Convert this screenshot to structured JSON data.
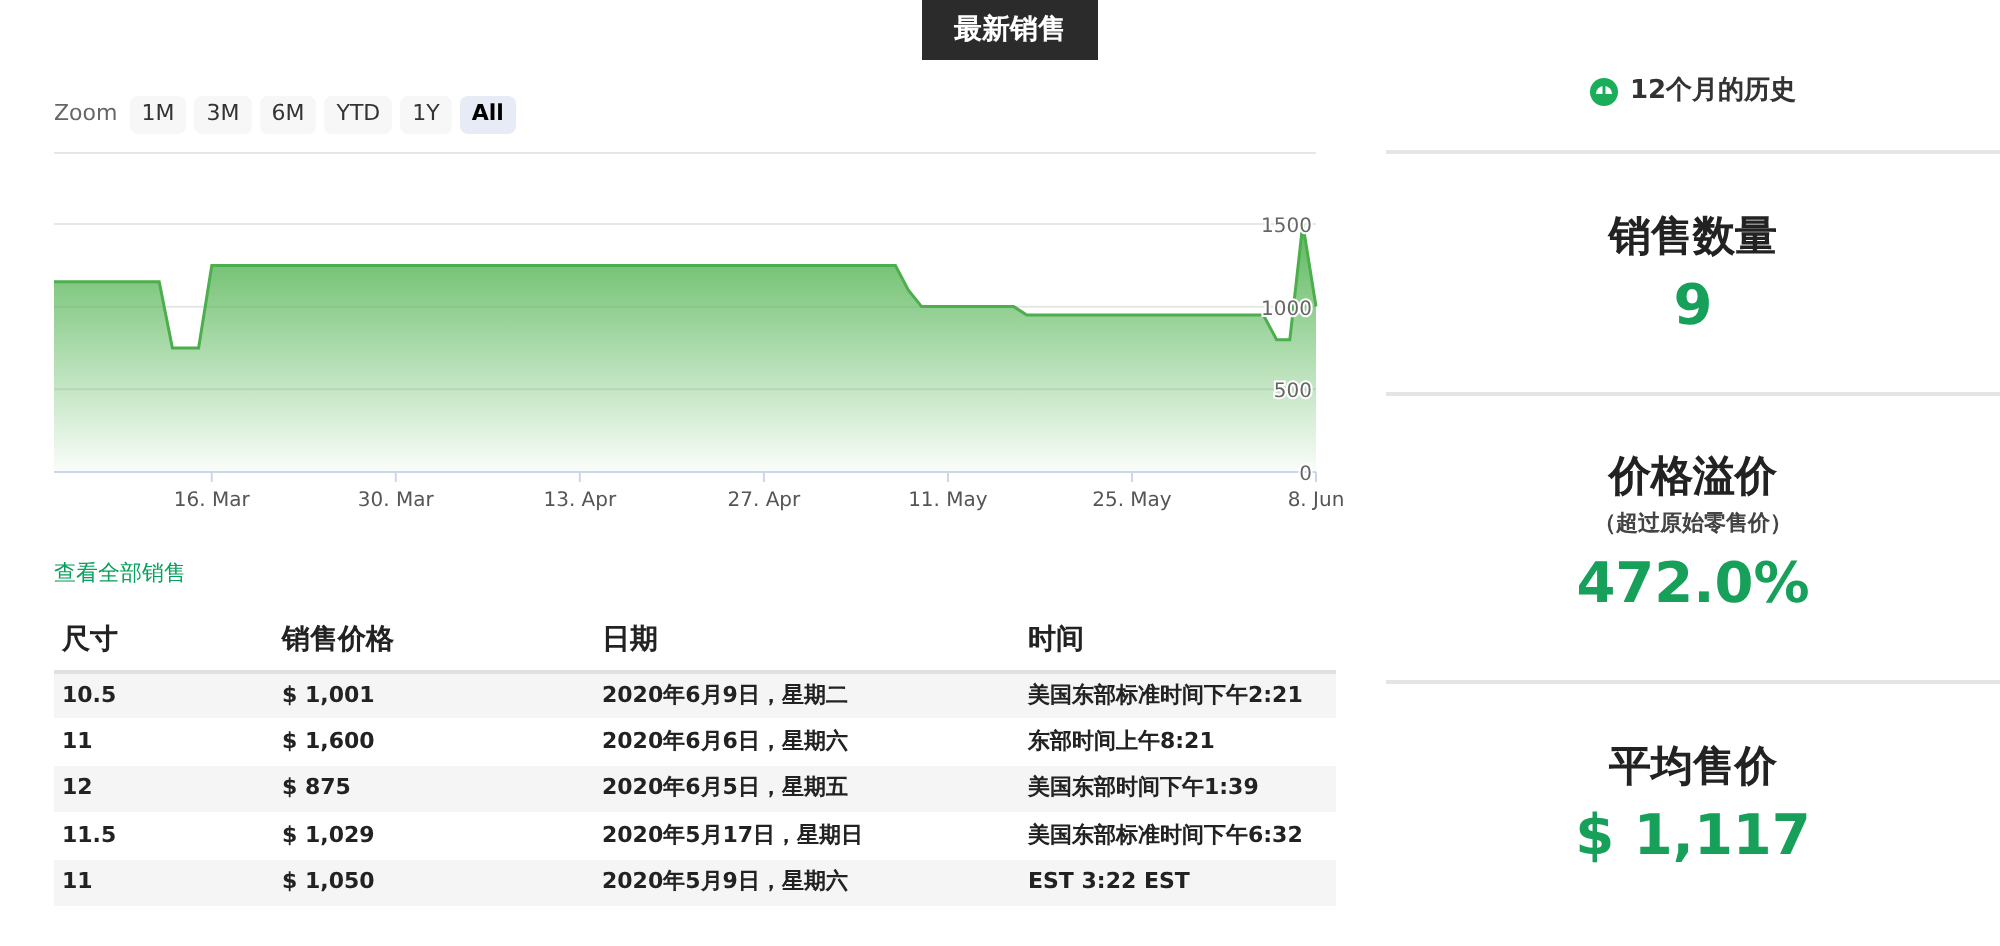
{
  "section_tab": {
    "label": "最新销售"
  },
  "zoom": {
    "label": "Zoom",
    "buttons": [
      {
        "label": "1M",
        "selected": false
      },
      {
        "label": "3M",
        "selected": false
      },
      {
        "label": "6M",
        "selected": false
      },
      {
        "label": "YTD",
        "selected": false
      },
      {
        "label": "1Y",
        "selected": false
      },
      {
        "label": "All",
        "selected": true
      }
    ]
  },
  "chart_data": {
    "type": "area",
    "categories": [
      null,
      null,
      null,
      null,
      null,
      null,
      null,
      null,
      null,
      null,
      null,
      null,
      "16. Mar",
      null,
      null,
      null,
      null,
      null,
      null,
      null,
      null,
      null,
      null,
      null,
      null,
      null,
      "30. Mar",
      null,
      null,
      null,
      null,
      null,
      null,
      null,
      null,
      null,
      null,
      null,
      null,
      null,
      "13. Apr",
      null,
      null,
      null,
      null,
      null,
      null,
      null,
      null,
      null,
      null,
      null,
      null,
      null,
      "27. Apr",
      null,
      null,
      null,
      null,
      null,
      null,
      null,
      null,
      null,
      null,
      null,
      null,
      null,
      "11. May",
      null,
      null,
      null,
      null,
      null,
      null,
      null,
      null,
      null,
      null,
      null,
      null,
      null,
      "25. May",
      null,
      null,
      null,
      null,
      null,
      null,
      null,
      null,
      null,
      null,
      null,
      null,
      null,
      "8. Jun"
    ],
    "series": [
      {
        "color": "#5cb85c",
        "values": [
          1150,
          1150,
          1150,
          1150,
          1150,
          1150,
          1150,
          1150,
          1150,
          750,
          750,
          750,
          1250,
          1250,
          1250,
          1250,
          1250,
          1250,
          1250,
          1250,
          1250,
          1250,
          1250,
          1250,
          1250,
          1250,
          1250,
          1250,
          1250,
          1250,
          1250,
          1250,
          1250,
          1250,
          1250,
          1250,
          1250,
          1250,
          1250,
          1250,
          1250,
          1250,
          1250,
          1250,
          1250,
          1250,
          1250,
          1250,
          1250,
          1250,
          1250,
          1250,
          1250,
          1250,
          1250,
          1250,
          1250,
          1250,
          1250,
          1250,
          1250,
          1250,
          1250,
          1250,
          1250,
          1100,
          1000,
          1000,
          1000,
          1000,
          1000,
          1000,
          1000,
          1000,
          950,
          950,
          950,
          950,
          950,
          950,
          950,
          950,
          950,
          950,
          950,
          950,
          950,
          950,
          950,
          950,
          950,
          950,
          950,
          800,
          800,
          1500,
          1000
        ]
      }
    ],
    "ylim": [
      0,
      1500
    ],
    "yticks": [
      0,
      500,
      1000,
      1500
    ]
  },
  "view_all_link": "查看全部销售",
  "table": {
    "columns": [
      "尺寸",
      "销售价格",
      "日期",
      "时间"
    ],
    "rows": [
      [
        "10.5",
        "$ 1,001",
        "2020年6月9日，星期二",
        "美国东部标准时间下午2:21"
      ],
      [
        "11",
        "$ 1,600",
        "2020年6月6日，星期六",
        "东部时间上午8:21"
      ],
      [
        "12",
        "$ 875",
        "2020年6月5日，星期五",
        "美国东部时间下午1:39"
      ],
      [
        "11.5",
        "$ 1,029",
        "2020年5月17日，星期日",
        "美国东部标准时间下午6:32"
      ],
      [
        "11",
        "$ 1,050",
        "2020年5月9日，星期六",
        "EST 3:22 EST"
      ]
    ]
  },
  "history": {
    "title": "12个月的历史"
  },
  "stats": [
    {
      "label": "销售数量",
      "value": "9"
    },
    {
      "label": "价格溢价",
      "sublabel": "（超过原始零售价）",
      "value": "472.0%"
    },
    {
      "label": "平均售价",
      "value": "$ 1,117"
    }
  ]
}
